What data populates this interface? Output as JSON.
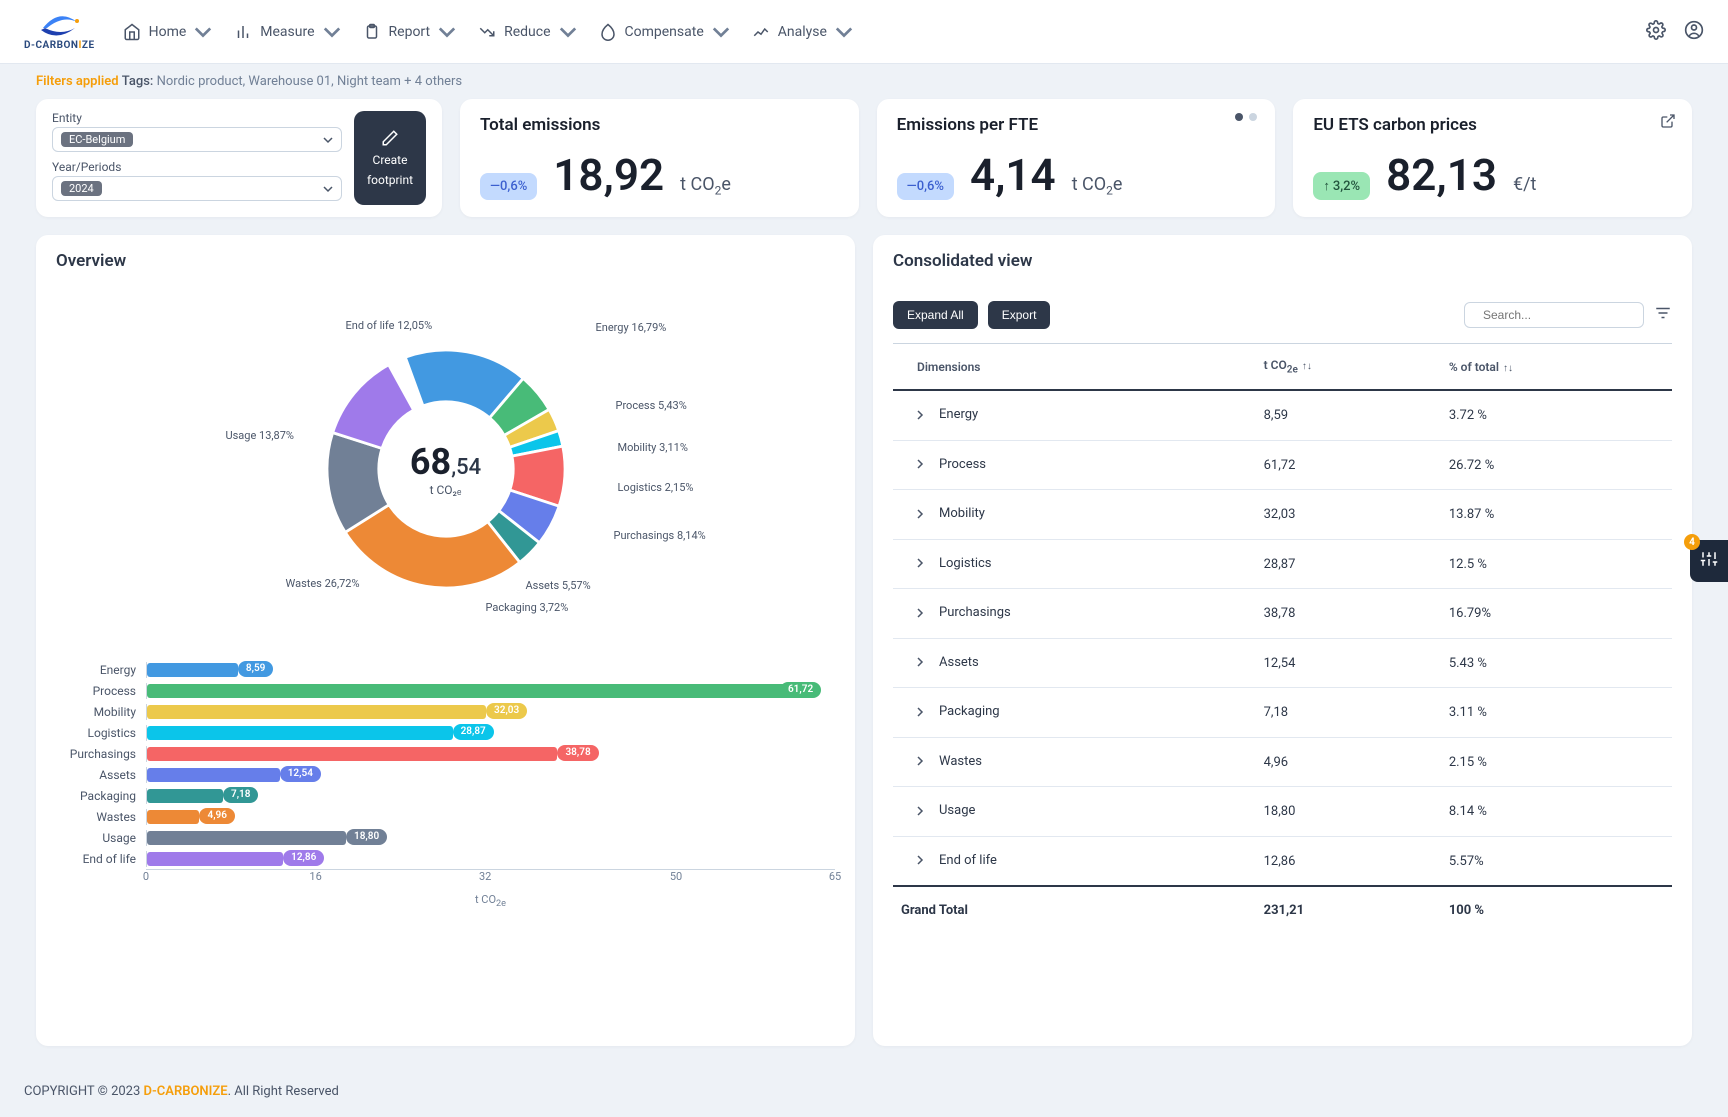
{
  "brand": {
    "name": "D-CARBONIZE",
    "prefix": "D-CARBON",
    "accent": "I",
    "suffix": "ZE"
  },
  "nav": {
    "items": [
      {
        "label": "Home",
        "icon": "home"
      },
      {
        "label": "Measure",
        "icon": "chart-bar"
      },
      {
        "label": "Report",
        "icon": "clipboard"
      },
      {
        "label": "Reduce",
        "icon": "trend-down"
      },
      {
        "label": "Compensate",
        "icon": "leaf"
      },
      {
        "label": "Analyse",
        "icon": "spark"
      }
    ]
  },
  "filters_bar": {
    "applied": "Filters applied",
    "tags_label": "Tags:",
    "tags_text": "Nordic product, Warehouse 01, Night team  + 4 others"
  },
  "filter_card": {
    "entity_label": "Entity",
    "entity_value": "EC-Belgium",
    "year_label": "Year/Periods",
    "year_value": "2024",
    "create_line1": "Create",
    "create_line2": "footprint"
  },
  "kpi": {
    "total": {
      "title": "Total emissions",
      "delta": "—0,6%",
      "value": "18,92",
      "unit_prefix": "t CO",
      "unit_suffix": "e"
    },
    "fte": {
      "title": "Emissions per FTE",
      "delta": "—0,6%",
      "value": "4,14",
      "unit_prefix": "t CO",
      "unit_suffix": "e"
    },
    "ets": {
      "title": "EU ETS carbon prices",
      "delta": "3,2%",
      "arrow": "↑",
      "value": "82,13",
      "unit": "€/t"
    }
  },
  "overview": {
    "title": "Overview",
    "donut_center_big": "68",
    "donut_center_small": ",54",
    "donut_unit": "t CO₂ₑ",
    "segments": [
      {
        "name": "Energy",
        "pct": 16.79,
        "color": "#4299e1",
        "label": "Energy 16,79%"
      },
      {
        "name": "Process",
        "pct": 5.43,
        "color": "#48bb78",
        "label": "Process 5,43%"
      },
      {
        "name": "Mobility",
        "pct": 3.11,
        "color": "#ecc94b",
        "label": "Mobility 3,11%"
      },
      {
        "name": "Logistics",
        "pct": 2.15,
        "color": "#0bc5ea",
        "label": "Logistics 2,15%"
      },
      {
        "name": "Purchasings",
        "pct": 8.14,
        "color": "#f56565",
        "label": "Purchasings 8,14%"
      },
      {
        "name": "Assets",
        "pct": 5.57,
        "color": "#667eea",
        "label": "Assets 5,57%"
      },
      {
        "name": "Packaging",
        "pct": 3.72,
        "color": "#319795",
        "label": "Packaging 3,72%"
      },
      {
        "name": "Wastes",
        "pct": 26.72,
        "color": "#ed8936",
        "label": "Wastes 26,72%"
      },
      {
        "name": "Usage",
        "pct": 13.87,
        "color": "#718096",
        "label": "Usage 13,87%"
      },
      {
        "name": "End of life",
        "pct": 12.05,
        "color": "#9f7aea",
        "label": "End of life 12,05%"
      }
    ]
  },
  "chart_data": [
    {
      "type": "pie",
      "title": "Overview (share of t CO₂ₑ)",
      "center_value": 68.54,
      "center_unit": "t CO₂ₑ",
      "series": [
        {
          "name": "Energy",
          "value": 16.79,
          "color": "#4299e1"
        },
        {
          "name": "Process",
          "value": 5.43,
          "color": "#48bb78"
        },
        {
          "name": "Mobility",
          "value": 3.11,
          "color": "#ecc94b"
        },
        {
          "name": "Logistics",
          "value": 2.15,
          "color": "#0bc5ea"
        },
        {
          "name": "Purchasings",
          "value": 8.14,
          "color": "#f56565"
        },
        {
          "name": "Assets",
          "value": 5.57,
          "color": "#667eea"
        },
        {
          "name": "Packaging",
          "value": 3.72,
          "color": "#319795"
        },
        {
          "name": "Wastes",
          "value": 26.72,
          "color": "#ed8936"
        },
        {
          "name": "Usage",
          "value": 13.87,
          "color": "#718096"
        },
        {
          "name": "End of life",
          "value": 12.05,
          "color": "#9f7aea"
        }
      ]
    },
    {
      "type": "bar",
      "orientation": "horizontal",
      "xlabel": "t CO₂ₑ",
      "xlim": [
        0,
        65
      ],
      "xticks": [
        0,
        16,
        32,
        50,
        65
      ],
      "categories": [
        "Energy",
        "Process",
        "Mobility",
        "Logistics",
        "Purchasings",
        "Assets",
        "Packaging",
        "Wastes",
        "Usage",
        "End of life"
      ],
      "values": [
        8.59,
        61.72,
        32.03,
        28.87,
        38.78,
        12.54,
        7.18,
        4.96,
        18.8,
        12.86
      ],
      "value_labels": [
        "8,59",
        "61,72",
        "32,03",
        "28,87",
        "38,78",
        "12,54",
        "7,18",
        "4,96",
        "18,80",
        "12,86"
      ],
      "colors": [
        "#4299e1",
        "#48bb78",
        "#ecc94b",
        "#0bc5ea",
        "#f56565",
        "#667eea",
        "#319795",
        "#ed8936",
        "#718096",
        "#9f7aea"
      ]
    }
  ],
  "bars": {
    "axis_title_prefix": "t CO",
    "max": 65,
    "ticks": [
      0,
      16,
      32,
      50,
      65
    ],
    "rows": [
      {
        "cat": "Energy",
        "val": 8.59,
        "label": "8,59",
        "color": "#4299e1"
      },
      {
        "cat": "Process",
        "val": 61.72,
        "label": "61,72",
        "color": "#48bb78"
      },
      {
        "cat": "Mobility",
        "val": 32.03,
        "label": "32,03",
        "color": "#ecc94b"
      },
      {
        "cat": "Logistics",
        "val": 28.87,
        "label": "28,87",
        "color": "#0bc5ea"
      },
      {
        "cat": "Purchasings",
        "val": 38.78,
        "label": "38,78",
        "color": "#f56565"
      },
      {
        "cat": "Assets",
        "val": 12.54,
        "label": "12,54",
        "color": "#667eea"
      },
      {
        "cat": "Packaging",
        "val": 7.18,
        "label": "7,18",
        "color": "#319795"
      },
      {
        "cat": "Wastes",
        "val": 4.96,
        "label": "4,96",
        "color": "#ed8936"
      },
      {
        "cat": "Usage",
        "val": 18.8,
        "label": "18,80",
        "color": "#718096"
      },
      {
        "cat": "End of life",
        "val": 12.86,
        "label": "12,86",
        "color": "#9f7aea"
      }
    ]
  },
  "consolidated": {
    "title": "Consolidated view",
    "expand": "Expand All",
    "export": "Export",
    "search_placeholder": "Search...",
    "headers": {
      "dim": "Dimensions",
      "tco": "t CO",
      "pct": "% of total"
    },
    "rows": [
      {
        "name": "Energy",
        "tco": "8,59",
        "pct": "3.72 %"
      },
      {
        "name": "Process",
        "tco": "61,72",
        "pct": "26.72 %"
      },
      {
        "name": "Mobility",
        "tco": "32,03",
        "pct": "13.87 %"
      },
      {
        "name": "Logistics",
        "tco": "28,87",
        "pct": "12.5 %"
      },
      {
        "name": "Purchasings",
        "tco": "38,78",
        "pct": "16.79%"
      },
      {
        "name": "Assets",
        "tco": "12,54",
        "pct": "5.43 %"
      },
      {
        "name": "Packaging",
        "tco": "7,18",
        "pct": "3.11 %"
      },
      {
        "name": "Wastes",
        "tco": "4,96",
        "pct": "2.15 %"
      },
      {
        "name": "Usage",
        "tco": "18,80",
        "pct": "8.14 %"
      },
      {
        "name": "End of life",
        "tco": "12,86",
        "pct": "5.57%"
      }
    ],
    "grand": {
      "name": "Grand Total",
      "tco": "231,21",
      "pct": "100 %"
    }
  },
  "floater": {
    "badge": "4"
  },
  "footer": {
    "copyright": "COPYRIGHT © 2023 ",
    "brand": "D-CARBONIZE",
    "rest": ". All Right Reserved"
  }
}
